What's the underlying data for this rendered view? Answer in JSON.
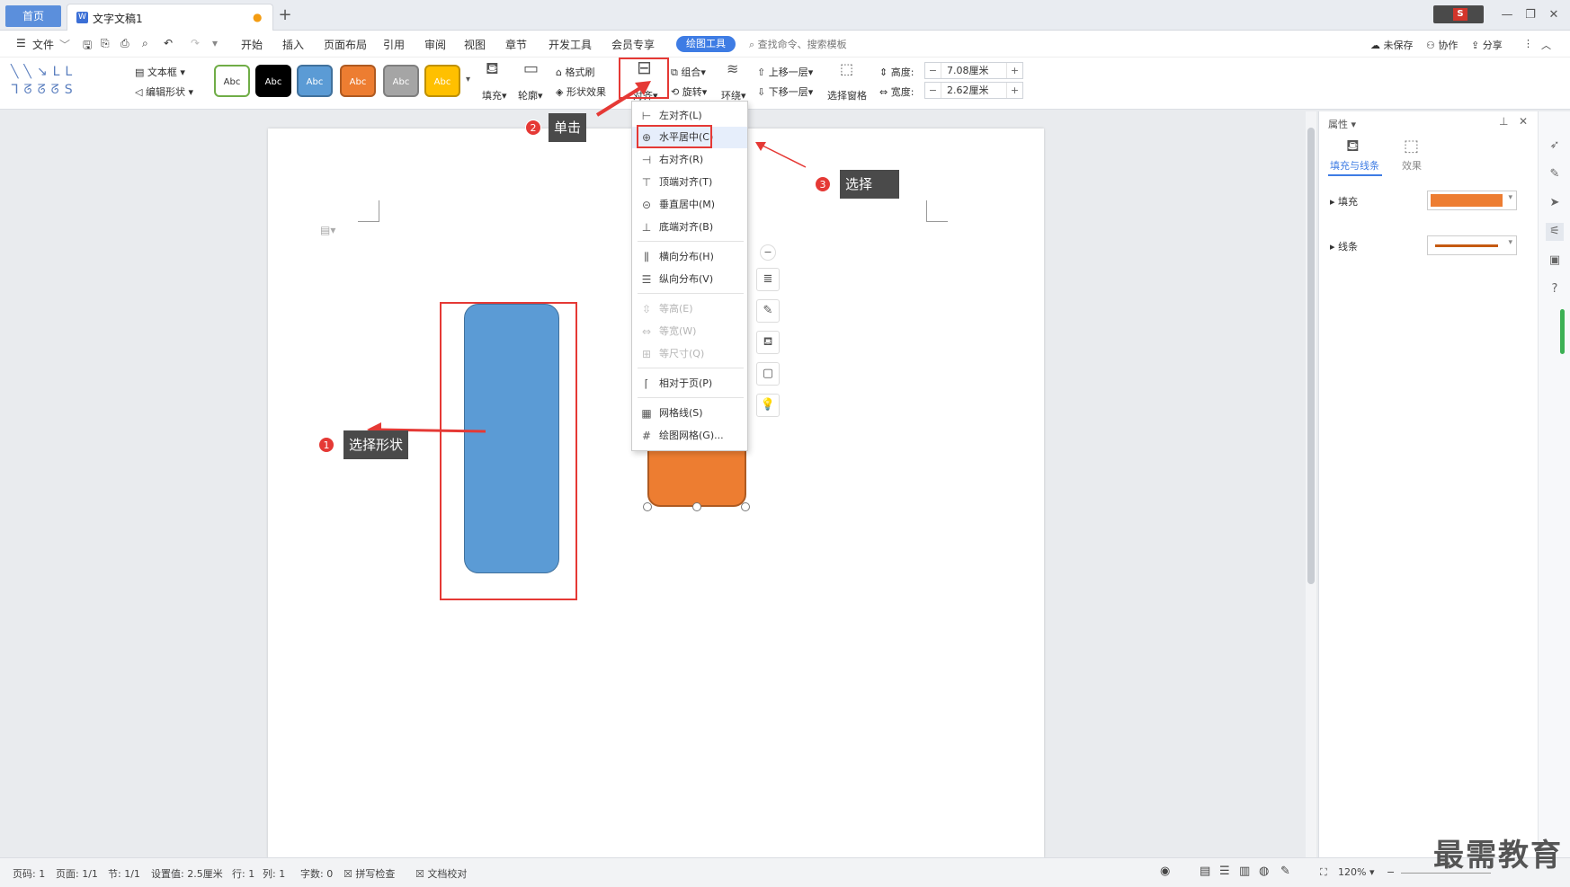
{
  "tabs": {
    "home": "首页",
    "document": "文字文稿1"
  },
  "menu": {
    "file": "文件",
    "items": [
      "开始",
      "插入",
      "页面布局",
      "引用",
      "审阅",
      "视图",
      "章节",
      "开发工具",
      "会员专享"
    ],
    "active": "绘图工具",
    "search_placeholder": "查找命令、搜索模板",
    "right": {
      "unsaved": "未保存",
      "collab": "协作",
      "share": "分享"
    }
  },
  "ribbon": {
    "textbox": "文本框",
    "edit_shape": "编辑形状",
    "styles": [
      {
        "label": "Abc",
        "bg": "#ffffff",
        "fg": "#333333",
        "border": "#70ad47"
      },
      {
        "label": "Abc",
        "bg": "#000000",
        "fg": "#ffffff",
        "border": "#000000"
      },
      {
        "label": "Abc",
        "bg": "#5b9bd5",
        "fg": "#ffffff",
        "border": "#41719c"
      },
      {
        "label": "Abc",
        "bg": "#ed7d31",
        "fg": "#ffffff",
        "border": "#ae5a21"
      },
      {
        "label": "Abc",
        "bg": "#a5a5a5",
        "fg": "#ffffff",
        "border": "#7f7f7f"
      },
      {
        "label": "Abc",
        "bg": "#ffc000",
        "fg": "#ffffff",
        "border": "#bf9000"
      }
    ],
    "fill": "填充",
    "outline": "轮廓",
    "format_painter": "格式刷",
    "shape_effects": "形状效果",
    "align": "对齐",
    "group": "组合",
    "rotate": "旋转",
    "wrap": "环绕",
    "bring_forward": "上移一层",
    "send_backward": "下移一层",
    "selection_pane": "选择窗格",
    "height_label": "高度:",
    "height_value": "7.08厘米",
    "width_label": "宽度:",
    "width_value": "2.62厘米"
  },
  "align_menu": {
    "items": [
      {
        "label": "左对齐(L)",
        "icon": "⊢"
      },
      {
        "label": "水平居中(C)",
        "icon": "⊕"
      },
      {
        "label": "右对齐(R)",
        "icon": "⊣"
      },
      {
        "label": "顶端对齐(T)",
        "icon": "⊤"
      },
      {
        "label": "垂直居中(M)",
        "icon": "⊝"
      },
      {
        "label": "底端对齐(B)",
        "icon": "⊥"
      },
      {
        "label": "横向分布(H)",
        "icon": "⫼"
      },
      {
        "label": "纵向分布(V)",
        "icon": "☰"
      },
      {
        "label": "等高(E)",
        "icon": "⇳"
      },
      {
        "label": "等宽(W)",
        "icon": "⇔"
      },
      {
        "label": "等尺寸(Q)",
        "icon": "⊞"
      },
      {
        "label": "相对于页(P)",
        "icon": "⌈"
      },
      {
        "label": "网格线(S)",
        "icon": "▦"
      },
      {
        "label": "绘图网格(G)...",
        "icon": "#"
      }
    ]
  },
  "callouts": {
    "step1": {
      "num": "1",
      "text": "选择形状"
    },
    "step2": {
      "num": "2",
      "text": "单击"
    },
    "step3": {
      "num": "3",
      "text": "选择"
    }
  },
  "props": {
    "title": "属性",
    "tab_fill_line": "填充与线条",
    "tab_effects": "效果",
    "fill_label": "填充",
    "line_label": "线条",
    "fill_color": "#ed7d31",
    "line_color": "#c55a11"
  },
  "status": {
    "page_num": "页码: 1",
    "pages": "页面: 1/1",
    "section": "节: 1/1",
    "setting": "设置值: 2.5厘米",
    "row": "行: 1",
    "col": "列: 1",
    "words": "字数: 0",
    "spellcheck": "拼写检查",
    "proofread": "文档校对",
    "zoom": "120%"
  },
  "watermark": "最需教育"
}
